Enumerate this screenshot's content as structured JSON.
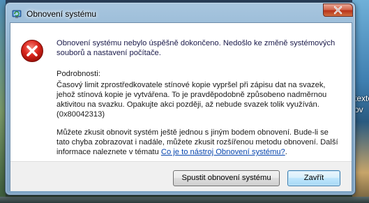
{
  "window": {
    "title": "Obnovení systému"
  },
  "message": {
    "main": "Obnovení systému nebylo úspěšně dokončeno. Nedošlo ke změně systémových souborů a nastavení počítače.",
    "details_label": "Podrobnosti:",
    "details": "Časový limit zprostředkovatele stínové kopie vypršel při zápisu dat na svazek, jehož stínová kopie je vytvářena. To je pravděpodobně způsobeno nadměrnou aktivitou na svazku. Opakujte akci později, až nebude svazek tolik využíván. (0x80042313)",
    "retry_prefix": "Můžete zkusit obnovit systém ještě jednou s jiným bodem obnovení. Bude-li se tato chyba zobrazovat i nadále, můžete zkusit rozšířenou metodu obnovení. Další informace naleznete v tématu ",
    "retry_link": "Co je to nástroj Obnovení systému?",
    "retry_suffix": "."
  },
  "buttons": {
    "restore": "Spustit obnovení systému",
    "close": "Zavřít"
  },
  "desktop": {
    "text_line1": "texto",
    "text_line2": "ov"
  },
  "icons": {
    "title": "system-restore-icon",
    "error": "error-icon",
    "close": "close-icon"
  },
  "colors": {
    "error_red": "#d9251d",
    "link": "#0645ad",
    "main_text": "#1a1a4a"
  }
}
